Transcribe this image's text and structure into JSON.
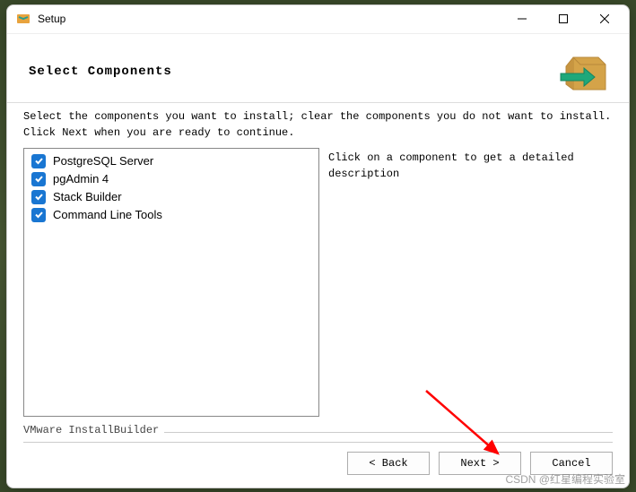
{
  "window": {
    "title": "Setup"
  },
  "header": {
    "title": "Select Components"
  },
  "instruction": "Select the components you want to install; clear the components you do not want to install. Click Next when you are ready to continue.",
  "components": {
    "item0": {
      "label": "PostgreSQL Server",
      "checked": true
    },
    "item1": {
      "label": "pgAdmin 4",
      "checked": true
    },
    "item2": {
      "label": "Stack Builder",
      "checked": true
    },
    "item3": {
      "label": "Command Line Tools",
      "checked": true
    }
  },
  "description_hint": "Click on a component to get a detailed description",
  "builder": "VMware InstallBuilder",
  "buttons": {
    "back": "< Back",
    "next": "Next >",
    "cancel": "Cancel"
  },
  "watermark": "CSDN @红星编程实验室"
}
